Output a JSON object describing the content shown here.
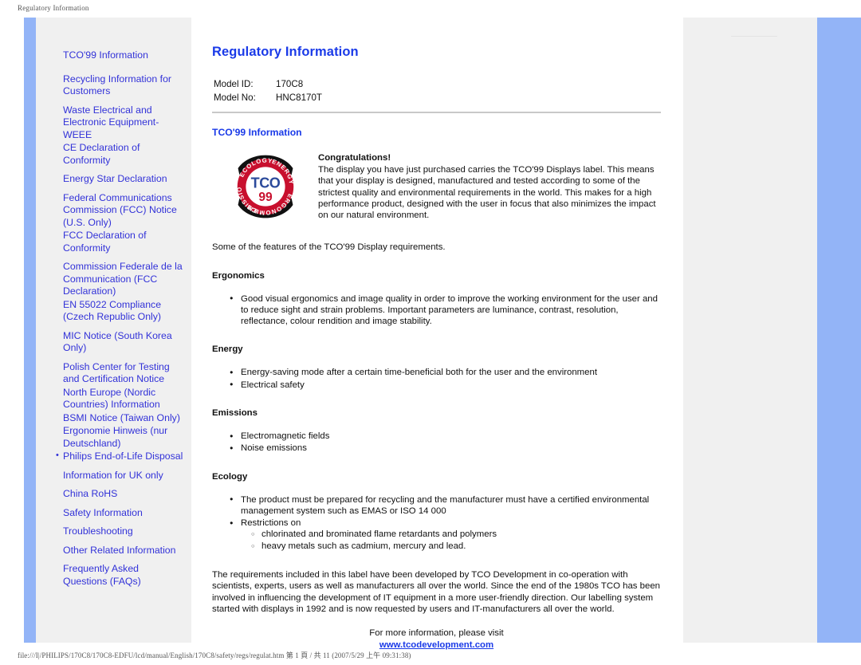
{
  "print": {
    "header": "Regulatory Information",
    "footer": "file:///I|/PHILIPS/170C8/170C8-EDFU/lcd/manual/English/170C8/safety/regs/regulat.htm 第 1 頁 / 共 11 (2007/5/29 上午 09:31:38)"
  },
  "colors": {
    "link": "#3232d8",
    "heading": "#1a3ae8",
    "accent_bar": "#93b4f7",
    "panel": "#f0f0f0",
    "rule": "#c8c8c8",
    "logo_red": "#c8102e",
    "logo_blue": "#2b4a9b"
  },
  "sidebar": {
    "items": [
      {
        "label": "TCO'99 Information",
        "bulleted": false,
        "spacing": "gap"
      },
      {
        "label": "Recycling Information for Customers",
        "bulleted": false,
        "spacing": "normal"
      },
      {
        "label": "Waste Electrical and Electronic Equipment-WEEE",
        "bulleted": false,
        "spacing": "tight"
      },
      {
        "label": "CE Declaration of Conformity",
        "bulleted": false,
        "spacing": "normal"
      },
      {
        "label": "Energy Star Declaration",
        "bulleted": false,
        "spacing": "normal"
      },
      {
        "label": "Federal Communications Commission (FCC) Notice (U.S. Only)",
        "bulleted": false,
        "spacing": "tight"
      },
      {
        "label": "FCC Declaration of Conformity",
        "bulleted": false,
        "spacing": "normal"
      },
      {
        "label": "Commission Federale de la Communication (FCC Declaration)",
        "bulleted": false,
        "spacing": "tight"
      },
      {
        "label": "EN 55022 Compliance (Czech Republic Only)",
        "bulleted": false,
        "spacing": "normal"
      },
      {
        "label": "MIC Notice (South Korea Only)",
        "bulleted": false,
        "spacing": "normal"
      },
      {
        "label": "Polish Center for Testing and Certification Notice",
        "bulleted": false,
        "spacing": "tight"
      },
      {
        "label": "North Europe (Nordic Countries) Information",
        "bulleted": false,
        "spacing": "tight"
      },
      {
        "label": "BSMI Notice (Taiwan Only)",
        "bulleted": false,
        "spacing": "tight"
      },
      {
        "label": "Ergonomie Hinweis (nur Deutschland)",
        "bulleted": false,
        "spacing": "tight"
      },
      {
        "label": "Philips End-of-Life Disposal",
        "bulleted": true,
        "spacing": "normal"
      },
      {
        "label": "Information for UK only",
        "bulleted": false,
        "spacing": "normal"
      },
      {
        "label": "China RoHS",
        "bulleted": false,
        "spacing": "normal"
      },
      {
        "label": "Safety Information",
        "bulleted": false,
        "spacing": "normal"
      },
      {
        "label": "Troubleshooting",
        "bulleted": false,
        "spacing": "normal"
      },
      {
        "label": "Other Related Information",
        "bulleted": false,
        "spacing": "normal"
      },
      {
        "label": "Frequently Asked Questions (FAQs)",
        "bulleted": false,
        "spacing": "normal"
      }
    ]
  },
  "main": {
    "title": "Regulatory Information",
    "model": {
      "id_label": "Model ID:",
      "id_value": "170C8",
      "no_label": "Model No:",
      "no_value": "HNC8170T"
    },
    "tco_heading": "TCO'99 Information",
    "logo": {
      "name": "tco-99-certification-logo",
      "brand": "TCO",
      "year": "99",
      "ring_words": [
        "ECOLOGY",
        "ENERGY",
        "ERGONOMICS",
        "EMISSIONS"
      ]
    },
    "congratulations": {
      "title": "Congratulations!",
      "body": "The display you have just purchased carries the TCO'99 Displays label. This means that your display is designed, manufactured and tested according to some of the strictest quality and environmental requirements in the world. This makes for a high performance product, designed with the user in focus that also minimizes the impact on our natural environment."
    },
    "features_intro": "Some of the features of the TCO'99 Display requirements.",
    "sections": [
      {
        "heading": "Ergonomics",
        "bullets": [
          {
            "text": "Good visual ergonomics and image quality in order to improve the working environment for the user and to reduce sight and strain problems. Important parameters are luminance, contrast, resolution, reflectance, colour rendition and image stability.",
            "sub": []
          }
        ]
      },
      {
        "heading": "Energy",
        "bullets": [
          {
            "text": "Energy-saving mode after a certain time-beneficial both for the user and the environment",
            "sub": []
          },
          {
            "text": "Electrical safety",
            "sub": []
          }
        ]
      },
      {
        "heading": "Emissions",
        "bullets": [
          {
            "text": "Electromagnetic fields",
            "sub": []
          },
          {
            "text": "Noise emissions",
            "sub": []
          }
        ]
      },
      {
        "heading": "Ecology",
        "bullets": [
          {
            "text": "The product must be prepared for recycling and the manufacturer must have a certified environmental management system such as EMAS or ISO 14 000",
            "sub": []
          },
          {
            "text": "Restrictions on",
            "sub": [
              "chlorinated and brominated flame retardants and polymers",
              "heavy metals such as cadmium, mercury and lead."
            ]
          }
        ]
      }
    ],
    "closing_paragraph": "The requirements included in this label have been developed by TCO Development in co-operation with scientists, experts, users as well as manufacturers all over the world. Since the end of the 1980s TCO has been involved in influencing the development of IT equipment in a more user-friendly direction. Our labelling system started with displays in 1992 and is now requested by users and IT-manufacturers all over the world.",
    "visit": {
      "prompt": "For more information, please visit",
      "link": "www.tcodevelopment.com"
    }
  }
}
